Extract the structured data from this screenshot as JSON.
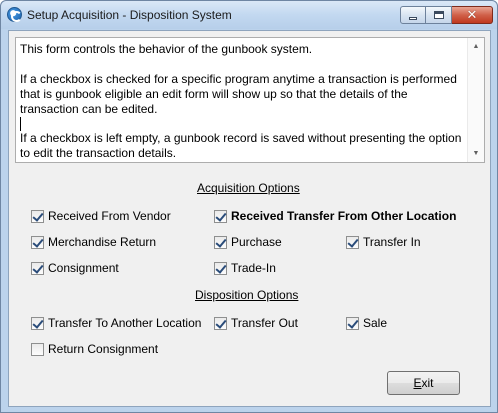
{
  "window": {
    "title": "Setup Acquisition - Disposition System",
    "close_glyph": "✕"
  },
  "description": {
    "paragraph1": "This form controls the behavior of the gunbook system.",
    "paragraph2": "If a checkbox is checked for a specific program anytime a transaction is performed that is gunbook eligible an edit form will show up so that the details of the transaction can be edited.",
    "paragraph3": "If a checkbox is left empty, a gunbook record is saved without presenting the option to edit the transaction details."
  },
  "acquisition": {
    "title": "Acquisition Options",
    "options": [
      {
        "label": "Received From Vendor",
        "checked": true
      },
      {
        "label": "Received Transfer From Other Location",
        "checked": true
      },
      {
        "label": "Merchandise Return",
        "checked": true
      },
      {
        "label": "Purchase",
        "checked": true
      },
      {
        "label": "Transfer In",
        "checked": true
      },
      {
        "label": "Consignment",
        "checked": true
      },
      {
        "label": "Trade-In",
        "checked": true
      }
    ]
  },
  "disposition": {
    "title": "Disposition Options",
    "options": [
      {
        "label": "Transfer To Another Location",
        "checked": true
      },
      {
        "label": "Transfer Out",
        "checked": true
      },
      {
        "label": "Sale",
        "checked": true
      },
      {
        "label": "Return Consignment",
        "checked": false
      }
    ]
  },
  "exit_button": {
    "mnemonic": "E",
    "rest": "xit"
  },
  "colors": {
    "title_bar": "#c2d8f0",
    "form_background": "#f0f0f0",
    "close_button": "#c0391f",
    "check_mark": "#2a4c7a"
  },
  "icons": {
    "app": "app-ring-icon",
    "minimize": "minimize-icon",
    "maximize": "maximize-icon",
    "close": "close-icon",
    "scroll_up": "scroll-up-arrow-icon",
    "scroll_down": "scroll-down-arrow-icon",
    "check": "checkmark-icon"
  }
}
